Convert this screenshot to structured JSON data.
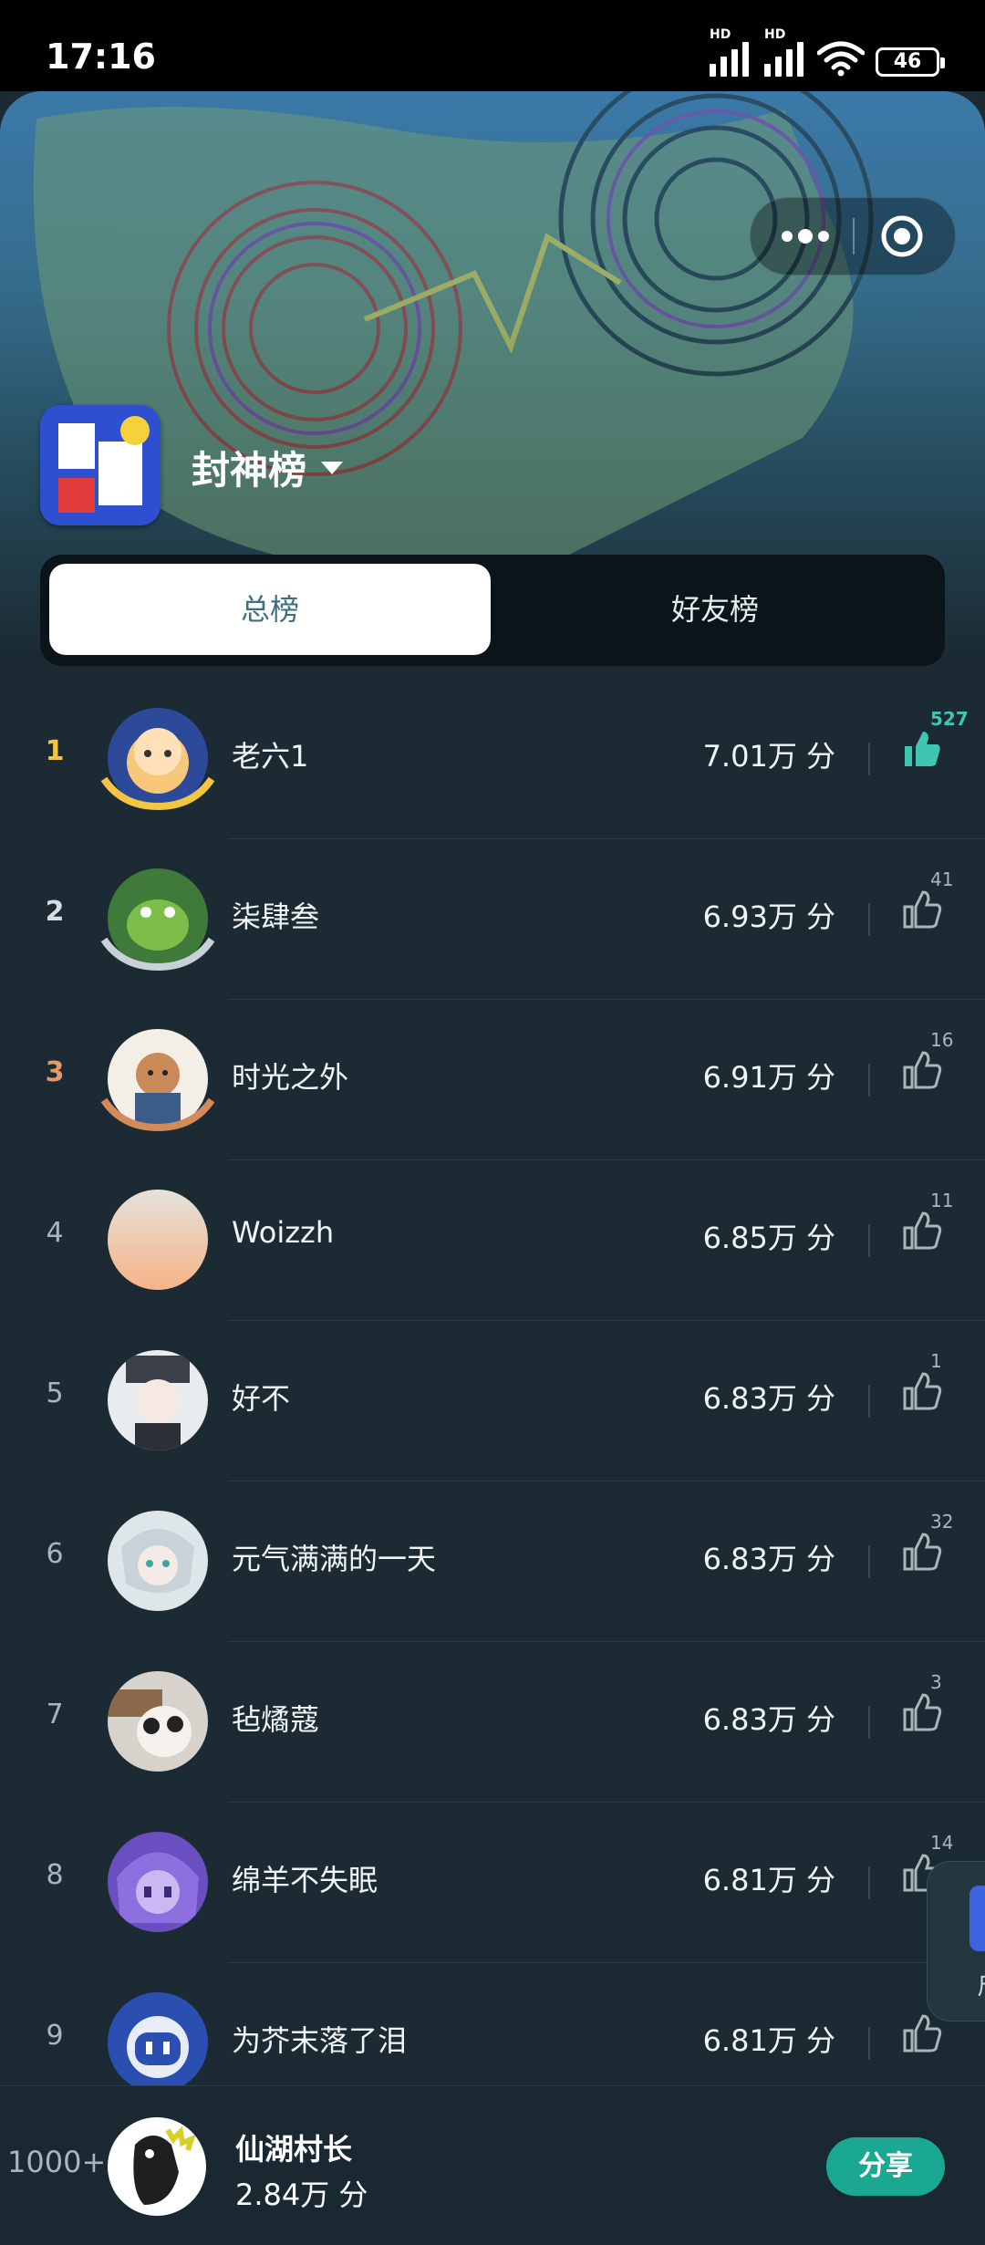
{
  "status_bar": {
    "time": "17:16",
    "network_label_1": "HD",
    "network_label_2": "HD",
    "battery": "46"
  },
  "header": {
    "board_title": "封神榜",
    "more_icon": "more-dots-icon",
    "close_icon": "target-circle-icon"
  },
  "tabs": [
    {
      "label": "总榜",
      "active": true
    },
    {
      "label": "好友榜",
      "active": false
    }
  ],
  "rows": [
    {
      "rank": "1",
      "name": "老六1",
      "score": "7.01万 分",
      "likes": "527",
      "liked": true,
      "avatar_color": "#2d4a9a"
    },
    {
      "rank": "2",
      "name": "柒肆叁",
      "score": "6.93万 分",
      "likes": "41",
      "liked": false,
      "avatar_color": "#3f7a3a"
    },
    {
      "rank": "3",
      "name": "时光之外",
      "score": "6.91万 分",
      "likes": "16",
      "liked": false,
      "avatar_color": "#f3efe6"
    },
    {
      "rank": "4",
      "name": "Woizzh",
      "score": "6.85万 分",
      "likes": "11",
      "liked": false,
      "avatar_color": "#f1c4a6"
    },
    {
      "rank": "5",
      "name": "好不",
      "score": "6.83万 分",
      "likes": "1",
      "liked": false,
      "avatar_color": "#e9ecef"
    },
    {
      "rank": "6",
      "name": "元气满满的一天",
      "score": "6.83万 分",
      "likes": "32",
      "liked": false,
      "avatar_color": "#dfe6ea"
    },
    {
      "rank": "7",
      "name": "毡燏蔻",
      "score": "6.83万 分",
      "likes": "3",
      "liked": false,
      "avatar_color": "#d8d2cc"
    },
    {
      "rank": "8",
      "name": "绵羊不失眠",
      "score": "6.81万 分",
      "likes": "14",
      "liked": false,
      "avatar_color": "#6a4fc0"
    },
    {
      "rank": "9",
      "name": "为芥末落了泪",
      "score": "6.81万 分",
      "likes": "",
      "liked": false,
      "avatar_color": "#2a4fb0"
    }
  ],
  "side_card": {
    "text": "斤"
  },
  "me": {
    "rank": "1000+",
    "name": "仙湖村长",
    "score": "2.84万 分",
    "share_label": "分享"
  },
  "colors": {
    "accent": "#1aa893",
    "liked": "#3fc6b2",
    "background": "#1b2a33"
  }
}
